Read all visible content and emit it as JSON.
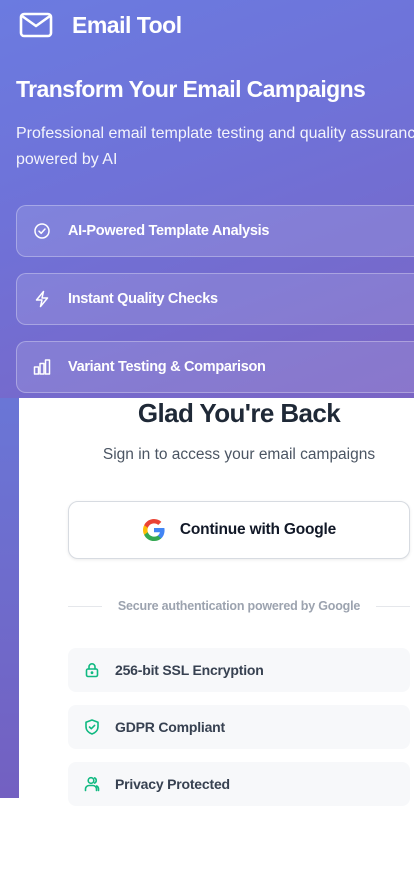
{
  "brand": {
    "name": "Email Tool",
    "icon": "mail-icon"
  },
  "hero": {
    "headline": "Transform Your Email Campaigns",
    "subline": "Professional email template testing and quality assurance powered by AI",
    "features": [
      {
        "icon": "check-circle-icon",
        "label": "AI-Powered Template Analysis"
      },
      {
        "icon": "lightning-icon",
        "label": "Instant Quality Checks"
      },
      {
        "icon": "bar-chart-icon",
        "label": "Variant Testing & Comparison"
      }
    ]
  },
  "signin": {
    "title": "Glad You're Back",
    "subtitle": "Sign in to access your email campaigns",
    "google_button": "Continue with Google",
    "divider": "Secure authentication powered by Google",
    "badges": [
      {
        "icon": "lock-icon",
        "label": "256-bit SSL Encryption"
      },
      {
        "icon": "shield-check-icon",
        "label": "GDPR Compliant"
      },
      {
        "icon": "users-icon",
        "label": "Privacy Protected"
      }
    ]
  },
  "colors": {
    "hero_gradient_start": "#6b7be0",
    "hero_gradient_end": "#7a64c4",
    "badge_icon": "#10b981",
    "title_text": "#1f2937"
  }
}
